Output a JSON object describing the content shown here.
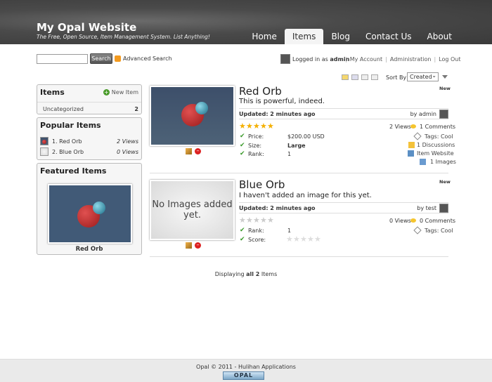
{
  "site": {
    "title": "My Opal Website",
    "tagline": "The Free, Open Source, Item Management System. List Anything!"
  },
  "nav": {
    "tabs": [
      "Home",
      "Items",
      "Blog",
      "Contact Us",
      "About"
    ],
    "active": "Items"
  },
  "search": {
    "input_value": "",
    "button_label": "Search",
    "advanced_label": "Advanced Search"
  },
  "user": {
    "logged_in_prefix": "Logged in as",
    "username": "admin",
    "links": [
      "My Account",
      "Administration",
      "Log Out"
    ]
  },
  "sort": {
    "label": "Sort By",
    "selected": "Created"
  },
  "sidebar": {
    "items_box": {
      "title": "Items",
      "new_item_label": "New Item",
      "categories": [
        {
          "name": "Uncategorized",
          "count": "2"
        }
      ]
    },
    "popular": {
      "title": "Popular Items",
      "entries": [
        {
          "rank_name": "1. Red Orb",
          "views": "2 Views"
        },
        {
          "rank_name": "2. Blue Orb",
          "views": "0 Views"
        }
      ]
    },
    "featured": {
      "title": "Featured Items",
      "item_name": "Red Orb"
    }
  },
  "items": [
    {
      "title": "Red Orb",
      "description": "This is powerful, indeed.",
      "badge": "New",
      "updated": "Updated: 2 minutes ago",
      "by": "by admin",
      "rating_filled": 5,
      "views": "2 Views",
      "comments": "1 Comments",
      "attributes": [
        {
          "label": "Price:",
          "value": "$200.00 USD"
        },
        {
          "label": "Size:",
          "value": "Large"
        },
        {
          "label": "Rank:",
          "value": "1"
        }
      ],
      "side_links": [
        "Tags: Cool",
        "1 Discussions",
        "Item Website",
        "1 Images"
      ]
    },
    {
      "title": "Blue Orb",
      "description": "I haven't added an image for this yet.",
      "badge": "New",
      "no_image_text": "No Images added yet.",
      "updated": "Updated: 2 minutes ago",
      "by": "by test",
      "rating_filled": 0,
      "views": "0 Views",
      "comments": "0 Comments",
      "attributes": [
        {
          "label": "Rank:",
          "value": "1"
        },
        {
          "label": "Score:",
          "value": ""
        }
      ],
      "side_links": [
        "Tags: Cool"
      ]
    }
  ],
  "listing": {
    "displaying_prefix": "Displaying",
    "displaying_bold": "all 2",
    "displaying_suffix": "Items"
  },
  "footer": {
    "copyright": "Opal © 2011 - Hulihan Applications",
    "badge": "OPAL"
  }
}
